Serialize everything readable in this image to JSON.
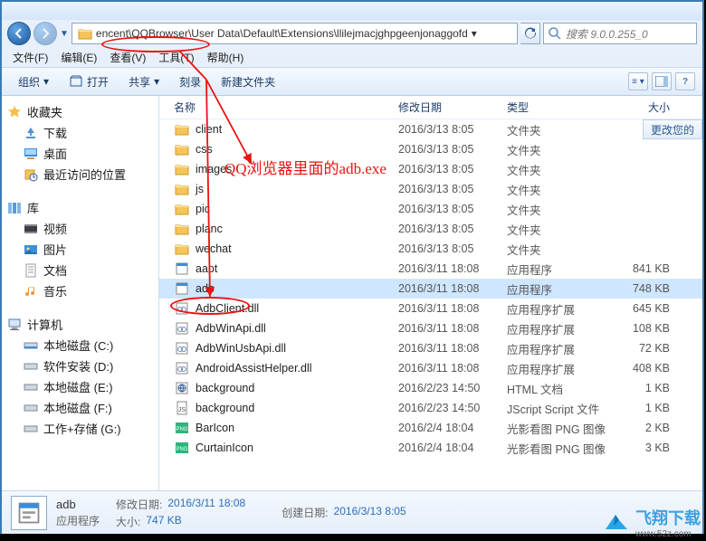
{
  "address_path": "encent\\QQBrowser\\User Data\\Default\\Extensions\\llilejmacjghpgeenjonaggofd",
  "search_placeholder": "搜索 9.0.0.255_0",
  "menu": [
    "文件(F)",
    "编辑(E)",
    "查看(V)",
    "工具(T)",
    "帮助(H)"
  ],
  "toolbar": {
    "organize": "组织",
    "open": "打开",
    "share": "共享",
    "burn": "刻录",
    "newfolder": "新建文件夹"
  },
  "change_hint": "更改您的",
  "nav": {
    "favorites": {
      "label": "收藏夹",
      "items": [
        "下载",
        "桌面",
        "最近访问的位置"
      ]
    },
    "libraries": {
      "label": "库",
      "items": [
        "视频",
        "图片",
        "文档",
        "音乐"
      ]
    },
    "computer": {
      "label": "计算机",
      "items": [
        "本地磁盘 (C:)",
        "软件安装 (D:)",
        "本地磁盘 (E:)",
        "本地磁盘 (F:)",
        "工作+存储 (G:)"
      ]
    }
  },
  "columns": {
    "name": "名称",
    "date": "修改日期",
    "type": "类型",
    "size": "大小"
  },
  "files": [
    {
      "icon": "folder",
      "name": "client",
      "date": "2016/3/13 8:05",
      "type": "文件夹",
      "size": ""
    },
    {
      "icon": "folder",
      "name": "css",
      "date": "2016/3/13 8:05",
      "type": "文件夹",
      "size": ""
    },
    {
      "icon": "folder",
      "name": "images",
      "date": "2016/3/13 8:05",
      "type": "文件夹",
      "size": ""
    },
    {
      "icon": "folder",
      "name": "js",
      "date": "2016/3/13 8:05",
      "type": "文件夹",
      "size": ""
    },
    {
      "icon": "folder",
      "name": "pic",
      "date": "2016/3/13 8:05",
      "type": "文件夹",
      "size": ""
    },
    {
      "icon": "folder",
      "name": "planc",
      "date": "2016/3/13 8:05",
      "type": "文件夹",
      "size": ""
    },
    {
      "icon": "folder",
      "name": "wechat",
      "date": "2016/3/13 8:05",
      "type": "文件夹",
      "size": ""
    },
    {
      "icon": "exe",
      "name": "aapt",
      "date": "2016/3/11 18:08",
      "type": "应用程序",
      "size": "841 KB"
    },
    {
      "icon": "exe",
      "name": "adb",
      "date": "2016/3/11 18:08",
      "type": "应用程序",
      "size": "748 KB",
      "selected": true
    },
    {
      "icon": "dll",
      "name": "AdbClient.dll",
      "date": "2016/3/11 18:08",
      "type": "应用程序扩展",
      "size": "645 KB"
    },
    {
      "icon": "dll",
      "name": "AdbWinApi.dll",
      "date": "2016/3/11 18:08",
      "type": "应用程序扩展",
      "size": "108 KB"
    },
    {
      "icon": "dll",
      "name": "AdbWinUsbApi.dll",
      "date": "2016/3/11 18:08",
      "type": "应用程序扩展",
      "size": "72 KB"
    },
    {
      "icon": "dll",
      "name": "AndroidAssistHelper.dll",
      "date": "2016/3/11 18:08",
      "type": "应用程序扩展",
      "size": "408 KB"
    },
    {
      "icon": "html",
      "name": "background",
      "date": "2016/2/23 14:50",
      "type": "HTML 文档",
      "size": "1 KB"
    },
    {
      "icon": "js",
      "name": "background",
      "date": "2016/2/23 14:50",
      "type": "JScript Script 文件",
      "size": "1 KB"
    },
    {
      "icon": "png",
      "name": "BarIcon",
      "date": "2016/2/4 18:04",
      "type": "光影看图 PNG 图像",
      "size": "2 KB"
    },
    {
      "icon": "png",
      "name": "CurtainIcon",
      "date": "2016/2/4 18:04",
      "type": "光影看图 PNG 图像",
      "size": "3 KB"
    }
  ],
  "details": {
    "name": "adb",
    "type": "应用程序",
    "mod_label": "修改日期:",
    "mod_val": "2016/3/11 18:08",
    "create_label": "创建日期:",
    "create_val": "2016/3/13 8:05",
    "size_label": "大小:",
    "size_val": "747 KB"
  },
  "annotation_text": "QQ浏览器里面的adb.exe",
  "watermark": {
    "brand": "飞翔下载",
    "url": "www.52z.com"
  }
}
